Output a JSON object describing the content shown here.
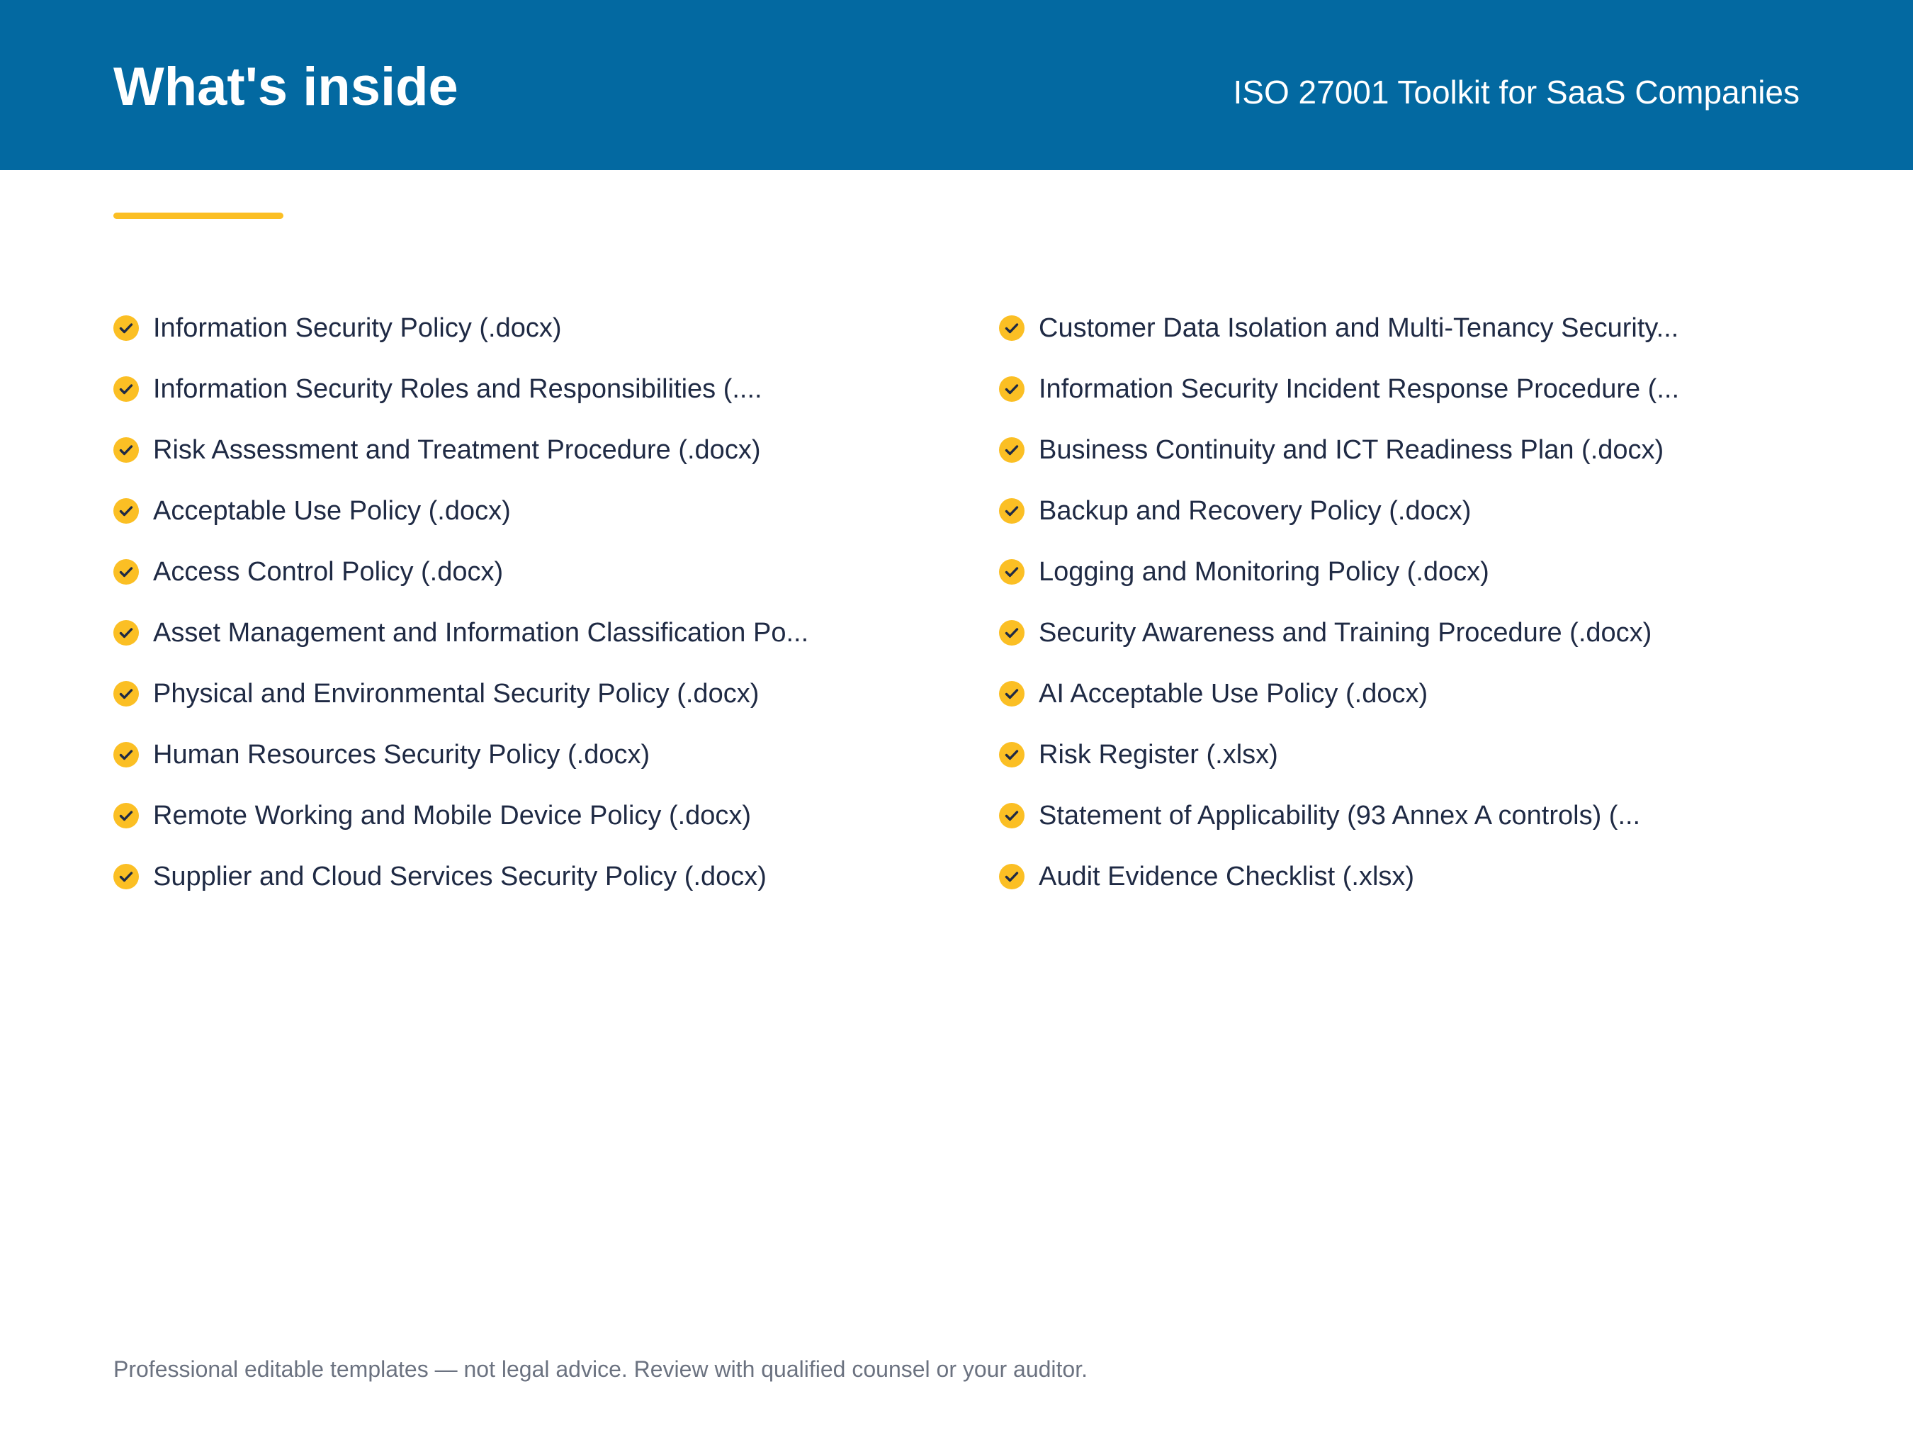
{
  "header": {
    "title": "What's inside",
    "subtitle": "ISO 27001 Toolkit for SaaS Companies"
  },
  "colors": {
    "header_background": "#0369a1",
    "accent": "#fbbf24",
    "text": "#1f2a44",
    "footer_text": "#6b7280"
  },
  "icons": {
    "list_bullet": "check-circle-icon"
  },
  "list_left": [
    "Information Security Policy (.docx)",
    "Information Security Roles and Responsibilities (....",
    "Risk Assessment and Treatment Procedure (.docx)",
    "Acceptable Use Policy (.docx)",
    "Access Control Policy (.docx)",
    "Asset Management and Information Classification Po...",
    "Physical and Environmental Security Policy (.docx)",
    "Human Resources Security Policy (.docx)",
    "Remote Working and Mobile Device Policy (.docx)",
    "Supplier and Cloud Services Security Policy (.docx)"
  ],
  "list_right": [
    "Customer Data Isolation and Multi-Tenancy Security...",
    "Information Security Incident Response Procedure (...",
    "Business Continuity and ICT Readiness Plan (.docx)",
    "Backup and Recovery Policy (.docx)",
    "Logging and Monitoring Policy (.docx)",
    "Security Awareness and Training Procedure (.docx)",
    "AI Acceptable Use Policy (.docx)",
    "Risk Register (.xlsx)",
    "Statement of Applicability (93 Annex A controls) (...",
    "Audit Evidence Checklist (.xlsx)"
  ],
  "footer": {
    "text": "Professional editable templates — not legal advice. Review with qualified counsel or your auditor."
  }
}
